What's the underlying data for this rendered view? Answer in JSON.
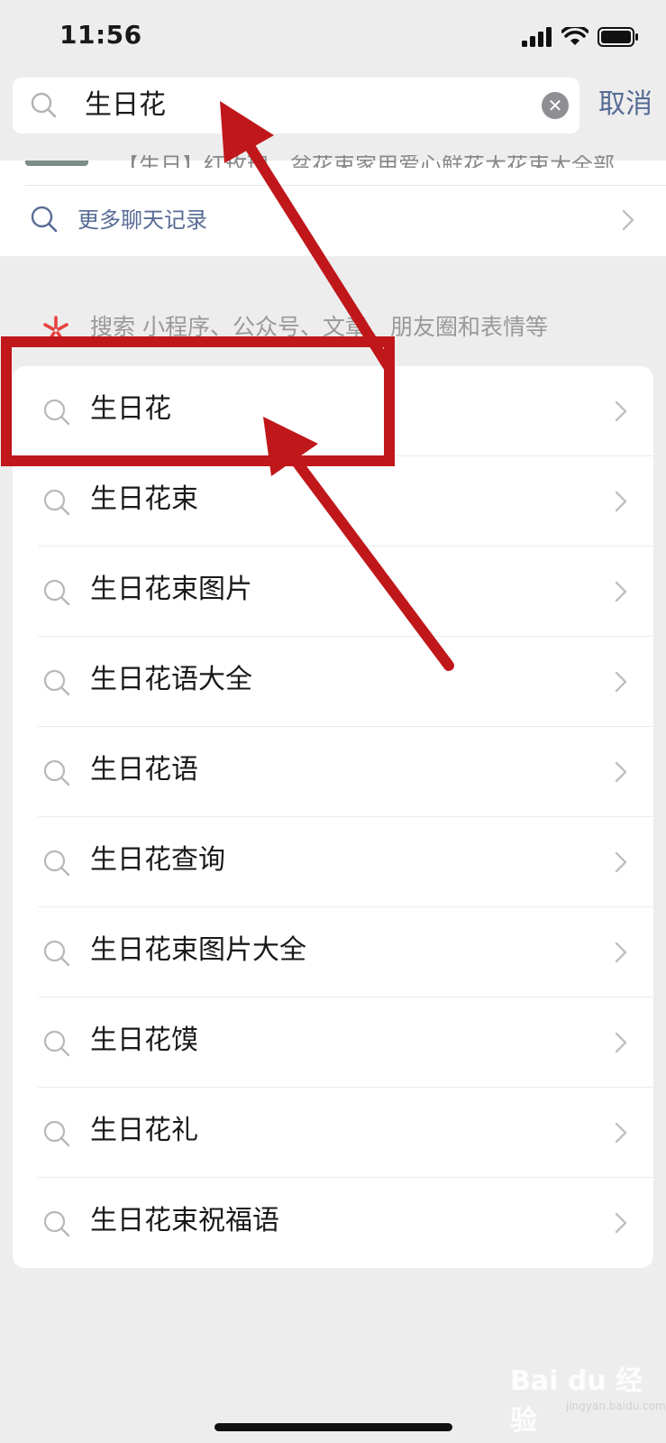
{
  "status_bar": {
    "time": "11:56"
  },
  "search": {
    "query": "生日花",
    "cancel_label": "取消"
  },
  "chat_results": {
    "snippet": "【生日】红玫瑰…盆花束家用爱心鲜花大花束大全部…",
    "more_label": "更多聊天记录"
  },
  "scope": {
    "text": "搜索 小程序、公众号、文章、朋友圈和表情等"
  },
  "suggestions": [
    {
      "label": "生日花"
    },
    {
      "label": "生日花束"
    },
    {
      "label": "生日花束图片"
    },
    {
      "label": "生日花语大全"
    },
    {
      "label": "生日花语"
    },
    {
      "label": "生日花查询"
    },
    {
      "label": "生日花束图片大全"
    },
    {
      "label": "生日花馍"
    },
    {
      "label": "生日花礼"
    },
    {
      "label": "生日花束祝福语"
    }
  ],
  "watermark": {
    "brand": "Bai du 经验",
    "site": "jingyan.baidu.com"
  },
  "colors": {
    "link": "#576b95",
    "annotation": "#c0171b",
    "scope_icon": "#e64340"
  }
}
